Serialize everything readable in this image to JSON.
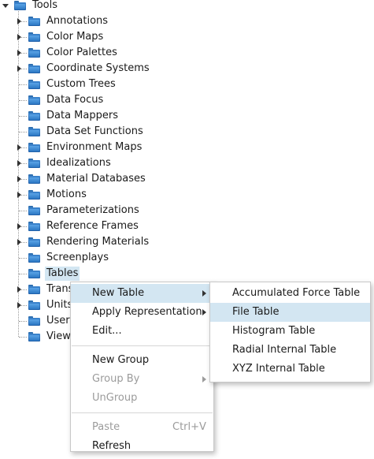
{
  "tree": {
    "root": {
      "label": "Tools"
    },
    "items": [
      {
        "label": "Annotations",
        "expandable": true
      },
      {
        "label": "Color Maps",
        "expandable": true
      },
      {
        "label": "Color Palettes",
        "expandable": true
      },
      {
        "label": "Coordinate Systems",
        "expandable": true
      },
      {
        "label": "Custom Trees",
        "expandable": false
      },
      {
        "label": "Data Focus",
        "expandable": false
      },
      {
        "label": "Data Mappers",
        "expandable": false
      },
      {
        "label": "Data Set Functions",
        "expandable": false
      },
      {
        "label": "Environment Maps",
        "expandable": true
      },
      {
        "label": "Idealizations",
        "expandable": true
      },
      {
        "label": "Material Databases",
        "expandable": true
      },
      {
        "label": "Motions",
        "expandable": true
      },
      {
        "label": "Parameterizations",
        "expandable": false
      },
      {
        "label": "Reference Frames",
        "expandable": true
      },
      {
        "label": "Rendering Materials",
        "expandable": true
      },
      {
        "label": "Screenplays",
        "expandable": false
      },
      {
        "label": "Tables",
        "expandable": false,
        "selected": true
      },
      {
        "label": "Trans",
        "expandable": true
      },
      {
        "label": "Units",
        "expandable": true
      },
      {
        "label": "User",
        "expandable": false
      },
      {
        "label": "View",
        "expandable": false
      }
    ]
  },
  "context_menu": {
    "items": [
      {
        "label": "New Table",
        "submenu": true,
        "highlighted": true
      },
      {
        "label": "Apply Representation",
        "submenu": true
      },
      {
        "label": "Edit..."
      },
      {
        "separator": true
      },
      {
        "label": "New Group"
      },
      {
        "label": "Group By",
        "submenu": true,
        "disabled": true
      },
      {
        "label": "UnGroup",
        "disabled": true
      },
      {
        "separator": true
      },
      {
        "label": "Paste",
        "accelerator": "Ctrl+V",
        "disabled": true
      },
      {
        "label": "Refresh"
      }
    ]
  },
  "submenu": {
    "items": [
      {
        "label": "Accumulated Force Table"
      },
      {
        "label": "File Table",
        "highlighted": true
      },
      {
        "label": "Histogram Table"
      },
      {
        "label": "Radial Internal Table"
      },
      {
        "label": "XYZ Internal Table"
      }
    ]
  },
  "colors": {
    "selection": "#d3e6f2",
    "folder": "#2c78c4",
    "disabled_text": "#9b9b9b"
  },
  "icons": {
    "folder": "folder-icon",
    "expand": "expand-arrow-icon",
    "collapse": "collapse-arrow-icon",
    "submenu": "submenu-arrow-icon"
  }
}
